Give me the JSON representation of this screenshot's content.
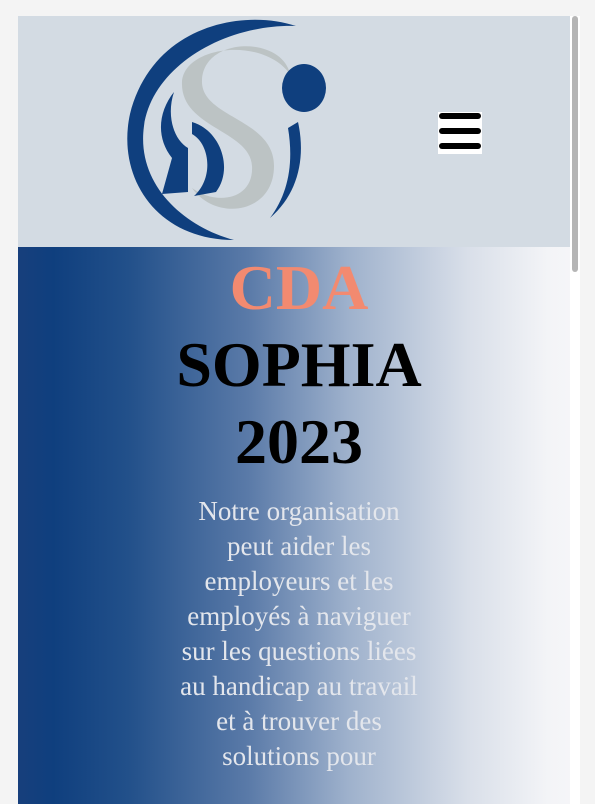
{
  "header": {
    "logo_icon": "ds-monogram-logo",
    "menu_icon": "hamburger-menu-icon"
  },
  "hero": {
    "title_highlight": "CDA",
    "title_line2": "SOPHIA",
    "title_line3": "2023",
    "description": "Notre organisation peut aider les employeurs et les employés à naviguer sur les questions liées au handicap au travail et à trouver des solutions pour"
  },
  "colors": {
    "header_background": "#d3dbe3",
    "brand_blue": "#0f3f7e",
    "logo_gray": "#bcc3c4",
    "accent_salmon": "#f28a70",
    "hero_text": "#e3e6ec"
  }
}
